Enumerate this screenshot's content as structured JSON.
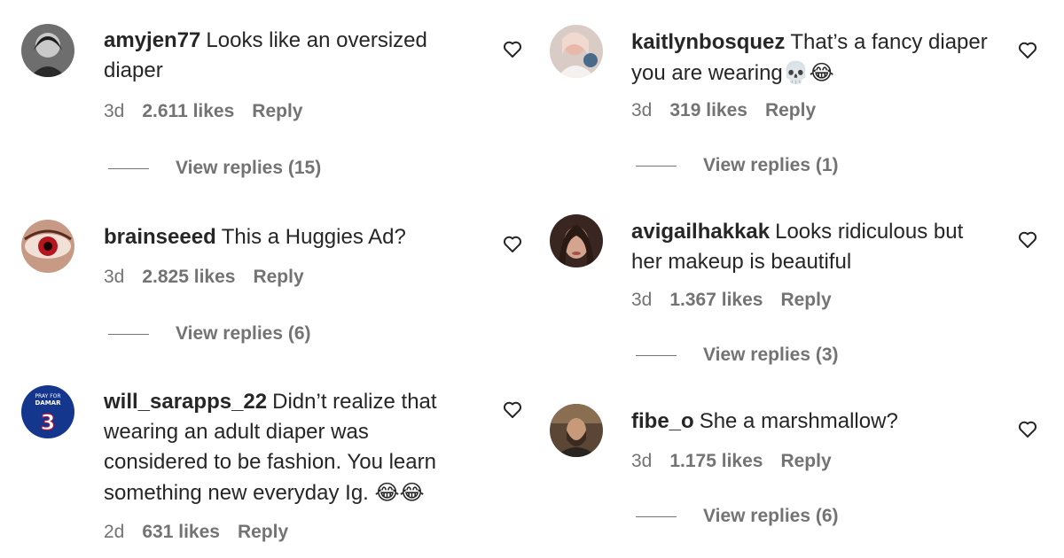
{
  "comments": [
    {
      "username": "amyjen77",
      "text_lines": [
        "Looks like an oversized",
        "diaper"
      ],
      "emoji": "",
      "time": "3d",
      "likes": "2.611 likes",
      "reply": "Reply",
      "view_replies": "View replies (15)"
    },
    {
      "username": "brainseeed",
      "text_lines": [
        "This a Huggies Ad?"
      ],
      "emoji": "",
      "time": "3d",
      "likes": "2.825 likes",
      "reply": "Reply",
      "view_replies": "View replies (6)"
    },
    {
      "username": "will_sarapps_22",
      "text_lines": [
        "Didn’t realize that",
        "wearing an adult diaper was",
        "considered to be fashion. You learn",
        "something new everyday Ig."
      ],
      "emoji": "😂😂",
      "time": "2d",
      "likes": "631 likes",
      "reply": "Reply",
      "avatar_text": [
        "PRAY FOR",
        "DAMAR",
        "3"
      ]
    },
    {
      "username": "kaitlynbosquez",
      "text_lines": [
        "That’s a fancy diaper",
        "you are wearing"
      ],
      "emoji": "💀😂",
      "time": "3d",
      "likes": "319 likes",
      "reply": "Reply",
      "view_replies": "View replies (1)"
    },
    {
      "username": "avigailhakkak",
      "text_lines": [
        "Looks ridiculous but",
        "her makeup is beautiful"
      ],
      "emoji": "",
      "time": "3d",
      "likes": "1.367 likes",
      "reply": "Reply",
      "view_replies": "View replies (3)"
    },
    {
      "username": "fibe_o",
      "text_lines": [
        "She a marshmallow?"
      ],
      "emoji": "",
      "time": "3d",
      "likes": "1.175 likes",
      "reply": "Reply",
      "view_replies": "View replies (6)"
    }
  ],
  "icons": {
    "like": "heart-outline-icon"
  },
  "colors": {
    "text": "#262626",
    "secondary": "#737373",
    "background": "#ffffff"
  }
}
